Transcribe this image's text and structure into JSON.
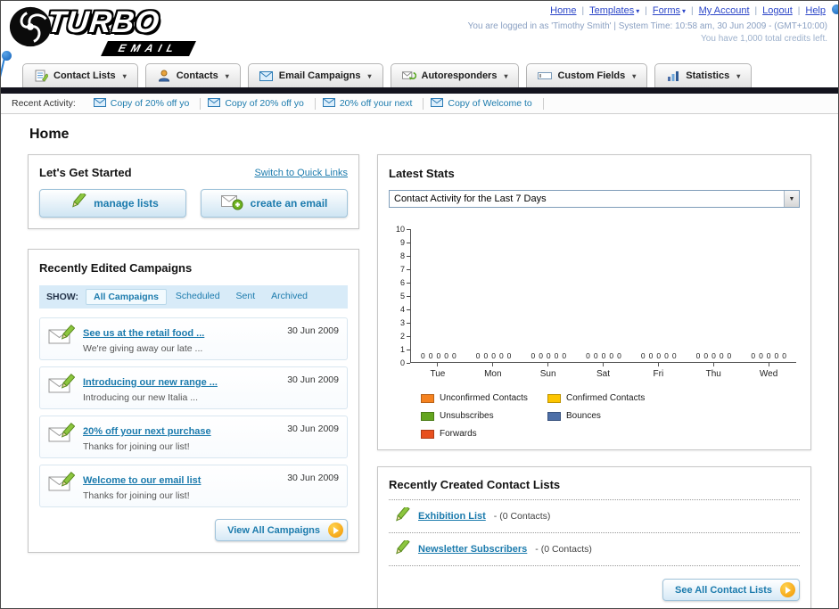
{
  "header": {
    "logo_text": "TURBO",
    "logo_subtext": "EMAIL",
    "links": [
      {
        "label": "Home",
        "dropdown": false
      },
      {
        "label": "Templates",
        "dropdown": true
      },
      {
        "label": "Forms",
        "dropdown": true
      },
      {
        "label": "My Account",
        "dropdown": false
      },
      {
        "label": "Logout",
        "dropdown": false
      },
      {
        "label": "Help",
        "dropdown": false
      }
    ],
    "login_info": "You are logged in as 'Timothy Smith' | System Time: 10:58 am, 30 Jun 2009 - (GMT+10:00)",
    "credits_info": "You have 1,000 total credits left."
  },
  "nav": {
    "tabs": [
      {
        "label": "Contact Lists",
        "icon": "contact-lists-icon"
      },
      {
        "label": "Contacts",
        "icon": "contacts-icon"
      },
      {
        "label": "Email Campaigns",
        "icon": "email-campaigns-icon"
      },
      {
        "label": "Autoresponders",
        "icon": "autoresponders-icon"
      },
      {
        "label": "Custom Fields",
        "icon": "custom-fields-icon"
      },
      {
        "label": "Statistics",
        "icon": "statistics-icon"
      }
    ]
  },
  "activity": {
    "label": "Recent Activity:",
    "items": [
      "Copy of 20% off yo",
      "Copy of 20% off yo",
      "20% off your next",
      "Copy of Welcome to"
    ]
  },
  "page": {
    "title": "Home"
  },
  "get_started": {
    "title": "Let's Get Started",
    "switch_link": "Switch to Quick Links",
    "manage_lists_label": "manage lists",
    "create_email_label": "create an email"
  },
  "campaigns": {
    "title": "Recently Edited Campaigns",
    "show_label": "SHOW:",
    "filters": [
      {
        "label": "All Campaigns",
        "selected": true
      },
      {
        "label": "Scheduled",
        "selected": false
      },
      {
        "label": "Sent",
        "selected": false
      },
      {
        "label": "Archived",
        "selected": false
      }
    ],
    "items": [
      {
        "title": "See us at the retail food ...",
        "subtitle": "We're giving away our late ...",
        "date": "30 Jun 2009"
      },
      {
        "title": "Introducing our new range ...",
        "subtitle": "Introducing our new Italia ...",
        "date": "30 Jun 2009"
      },
      {
        "title": "20% off your next purchase",
        "subtitle": "Thanks for joining our list!",
        "date": "30 Jun 2009"
      },
      {
        "title": "Welcome to our email list",
        "subtitle": "Thanks for joining our list!",
        "date": "30 Jun 2009"
      }
    ],
    "view_all_label": "View All Campaigns"
  },
  "stats": {
    "title": "Latest Stats",
    "dropdown_value": "Contact Activity for the Last 7 Days"
  },
  "chart_data": {
    "type": "bar",
    "title": "Contact Activity for the Last 7 Days",
    "categories": [
      "Tue",
      "Mon",
      "Sun",
      "Sat",
      "Fri",
      "Thu",
      "Wed"
    ],
    "series": [
      {
        "name": "Unconfirmed Contacts",
        "color": "#f5821f",
        "values": [
          0,
          0,
          0,
          0,
          0,
          0,
          0
        ]
      },
      {
        "name": "Confirmed Contacts",
        "color": "#fdc500",
        "values": [
          0,
          0,
          0,
          0,
          0,
          0,
          0
        ]
      },
      {
        "name": "Unsubscribes",
        "color": "#64a51f",
        "values": [
          0,
          0,
          0,
          0,
          0,
          0,
          0
        ]
      },
      {
        "name": "Bounces",
        "color": "#4d6fa8",
        "values": [
          0,
          0,
          0,
          0,
          0,
          0,
          0
        ]
      },
      {
        "name": "Forwards",
        "color": "#e8501e",
        "values": [
          0,
          0,
          0,
          0,
          0,
          0,
          0
        ]
      }
    ],
    "xlabel": "",
    "ylabel": "",
    "ylim": [
      0,
      10
    ],
    "y_step": 1,
    "grid": false,
    "legend_position": "bottom"
  },
  "contact_lists": {
    "title": "Recently Created Contact Lists",
    "items": [
      {
        "name": "Exhibition List",
        "detail": "- (0 Contacts)"
      },
      {
        "name": "Newsletter Subscribers",
        "detail": "- (0 Contacts)"
      }
    ],
    "see_all_label": "See All Contact Lists"
  },
  "colors": {
    "link": "#1c7bad",
    "accent_orange": "#f29400",
    "dark_bar": "#13131d"
  }
}
